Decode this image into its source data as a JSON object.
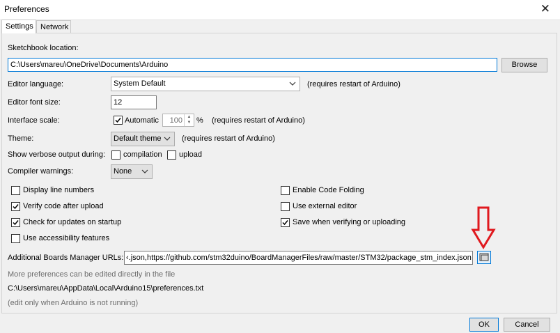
{
  "window": {
    "title": "Preferences",
    "close_glyph": "✕"
  },
  "tabs": [
    {
      "label": "Settings",
      "active": true
    },
    {
      "label": "Network",
      "active": false
    }
  ],
  "sketchbook": {
    "label": "Sketchbook location:",
    "path": "C:\\Users\\mareu\\OneDrive\\Documents\\Arduino",
    "browse_label": "Browse"
  },
  "editor_language": {
    "label": "Editor language:",
    "value": "System Default",
    "note": "(requires restart of Arduino)"
  },
  "editor_font_size": {
    "label": "Editor font size:",
    "value": "12"
  },
  "interface_scale": {
    "label": "Interface scale:",
    "automatic_label": "Automatic",
    "automatic_checked": true,
    "value": "100",
    "unit": "%",
    "note": "(requires restart of Arduino)"
  },
  "theme": {
    "label": "Theme:",
    "value": "Default theme",
    "note": "(requires restart of Arduino)"
  },
  "verbose": {
    "label": "Show verbose output during:",
    "compilation_label": "compilation",
    "compilation_checked": false,
    "upload_label": "upload",
    "upload_checked": false
  },
  "compiler_warnings": {
    "label": "Compiler warnings:",
    "value": "None"
  },
  "options_left": [
    {
      "label": "Display line numbers",
      "checked": false
    },
    {
      "label": "Verify code after upload",
      "checked": true
    },
    {
      "label": "Check for updates on startup",
      "checked": true
    },
    {
      "label": "Use accessibility features",
      "checked": false
    }
  ],
  "options_right": [
    {
      "label": "Enable Code Folding",
      "checked": false
    },
    {
      "label": "Use external editor",
      "checked": false
    },
    {
      "label": "Save when verifying or uploading",
      "checked": true
    }
  ],
  "boards_manager": {
    "label": "Additional Boards Manager URLs:",
    "value": "‹.json,https://github.com/stm32duino/BoardManagerFiles/raw/master/STM32/package_stm_index.json"
  },
  "footer": {
    "more_prefs": "More preferences can be edited directly in the file",
    "prefs_path": "C:\\Users\\mareu\\AppData\\Local\\Arduino15\\preferences.txt",
    "edit_note": "(edit only when Arduino is not running)"
  },
  "buttons": {
    "ok": "OK",
    "cancel": "Cancel"
  },
  "colors": {
    "annotation_arrow": "#e0191e",
    "focus_border": "#0078d7"
  }
}
